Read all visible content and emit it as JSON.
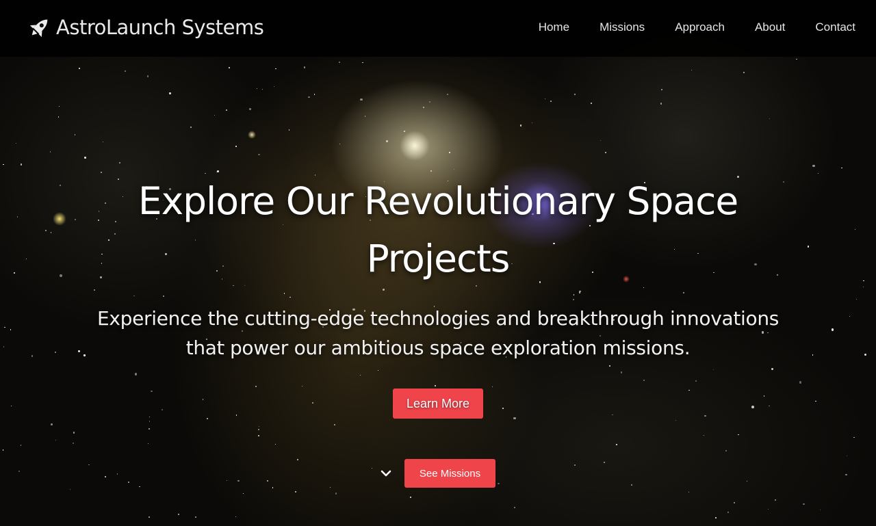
{
  "brand": {
    "name": "AstroLaunch Systems",
    "icon": "rocket-icon"
  },
  "nav": {
    "items": [
      {
        "label": "Home"
      },
      {
        "label": "Missions"
      },
      {
        "label": "Approach"
      },
      {
        "label": "About"
      },
      {
        "label": "Contact"
      }
    ]
  },
  "hero": {
    "title": "Explore Our Revolutionary Space Projects",
    "subtitle": "Experience the cutting-edge technologies and breakthrough innovations that power our ambitious space exploration missions.",
    "primary_button": "Learn More",
    "scroll_icon": "chevron-down-icon",
    "secondary_button": "See Missions"
  },
  "colors": {
    "accent": "#f0444b",
    "navbar_bg": "#000000",
    "text": "#ffffff"
  }
}
